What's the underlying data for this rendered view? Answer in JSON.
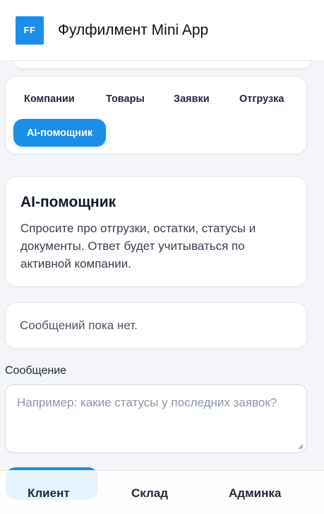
{
  "header": {
    "logo_text": "FF",
    "title": "Фулфилмент Mini App",
    "accent_color": "#1b8fe8"
  },
  "tabs": {
    "items": [
      "Компании",
      "Товары",
      "Заявки",
      "Отгрузка"
    ],
    "active": "AI-помощник"
  },
  "assistant": {
    "title": "AI-помощник",
    "description": "Спросите про отгрузки, остатки, статусы и документы. Ответ будет учитываться по активной компании."
  },
  "messages": {
    "empty_text": "Сообщений пока нет."
  },
  "composer": {
    "label": "Сообщение",
    "placeholder": "Например: какие статусы у последних заявок?",
    "value": ""
  },
  "bottom_nav": {
    "items": [
      "Клиент",
      "Склад",
      "Админка"
    ]
  }
}
